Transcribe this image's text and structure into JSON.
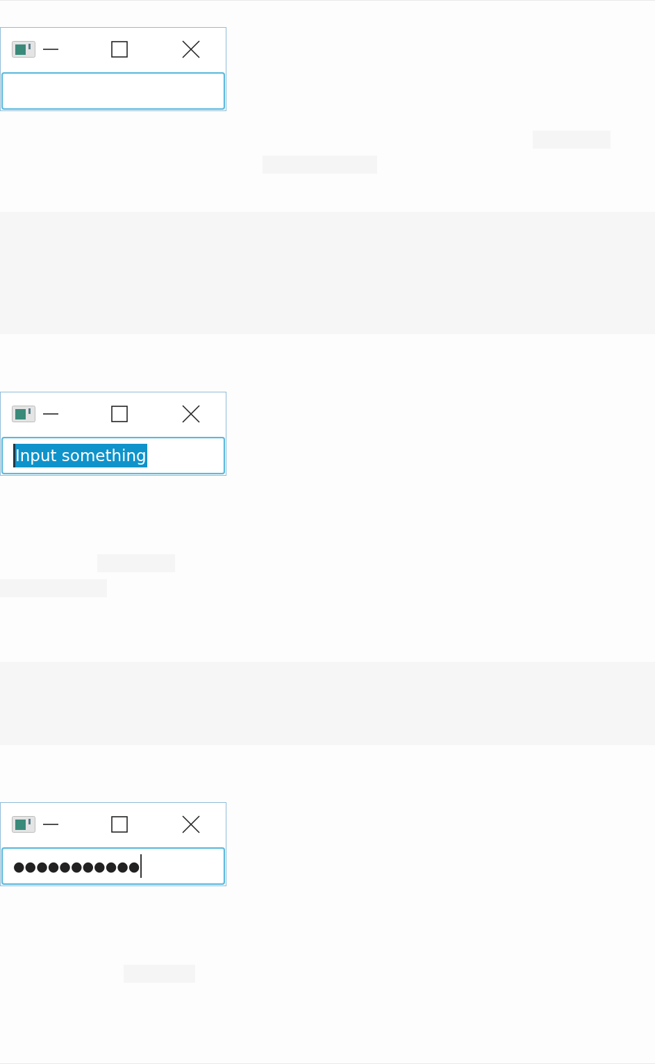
{
  "windows": [
    {
      "field": {
        "kind": "empty"
      }
    },
    {
      "field": {
        "kind": "selected",
        "value": "Input something"
      }
    },
    {
      "field": {
        "kind": "password",
        "value": "●●●●●●●●●●●"
      }
    }
  ]
}
